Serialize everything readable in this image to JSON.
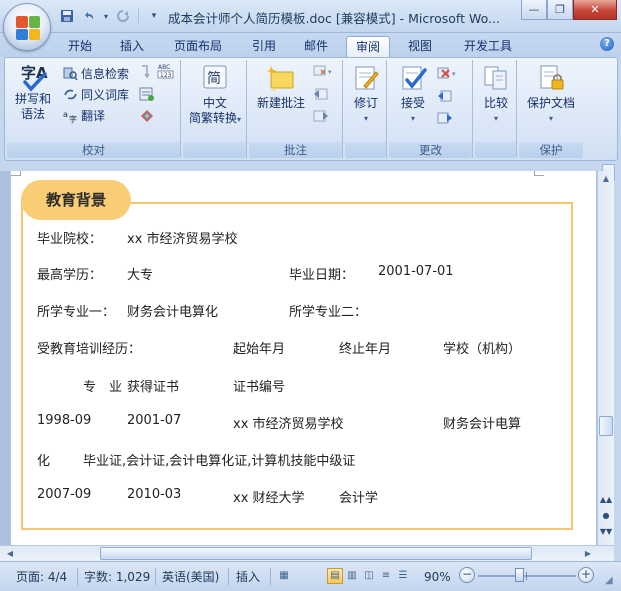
{
  "window": {
    "title": "成本会计师个人简历模板.doc [兼容模式] - Microsoft Wo...",
    "minimize": "—",
    "maximize": "❐",
    "close": "✕"
  },
  "qat": {
    "save_icon": "save-icon",
    "undo_icon": "undo-icon",
    "redo_icon": "redo-icon",
    "customize": "▾"
  },
  "tabs": [
    "开始",
    "插入",
    "页面布局",
    "引用",
    "邮件",
    "审阅",
    "视图",
    "开发工具"
  ],
  "active_tab": "审阅",
  "help": "?",
  "ribbon": {
    "proofing": {
      "label": "校对",
      "spelling": {
        "line1": "拼写和",
        "line2": "语法"
      },
      "research": "信息检索",
      "thesaurus": "同义词库",
      "translate": "翻译"
    },
    "chinese": {
      "label": "",
      "convert": {
        "line1": "中文",
        "line2": "简繁转换"
      }
    },
    "comments": {
      "label": "批注",
      "new_comment": "新建批注"
    },
    "tracking": {
      "label": "",
      "track": "修订"
    },
    "changes": {
      "label": "更改",
      "accept": "接受"
    },
    "compare": {
      "label": "",
      "compare": "比较"
    },
    "protect": {
      "label": "保护",
      "protect_doc": "保护文档"
    }
  },
  "document": {
    "section_title": "教育背景",
    "rows": [
      {
        "label": "毕业院校：",
        "value": "xx 市经济贸易学校"
      },
      {
        "label": "最高学历：",
        "value": "大专",
        "label2": "毕业日期：",
        "value2": "2001-07-01"
      },
      {
        "label": "所学专业一：",
        "value": "财务会计电算化",
        "label2": "所学专业二："
      },
      {
        "label": "受教育培训经历：",
        "col_start": "起始年月",
        "col_end": "终止年月",
        "col_school": "学校（机构）"
      },
      {
        "col_major": "专　业",
        "col_cert": "获得证书",
        "col_certno": "证书编号"
      },
      {
        "start": "1998-09",
        "end": "2001-07",
        "school": "xx 市经济贸易学校",
        "major": "财务会计电算"
      },
      {
        "wrap": "化",
        "certs": "毕业证,会计证,会计电算化证,计算机技能中级证"
      },
      {
        "start": "2007-09",
        "end": "2010-03",
        "school": "xx 财经大学",
        "major": "会计学"
      }
    ]
  },
  "statusbar": {
    "page": "页面: 4/4",
    "words": "字数: 1,029",
    "language": "英语(美国)",
    "mode": "插入",
    "zoom": "90%",
    "zoom_minus": "−",
    "zoom_plus": "+"
  },
  "colors": {
    "accent_orange": "#f9cd74",
    "box_border": "#f7c66c",
    "ribbon_text": "#15306b"
  }
}
